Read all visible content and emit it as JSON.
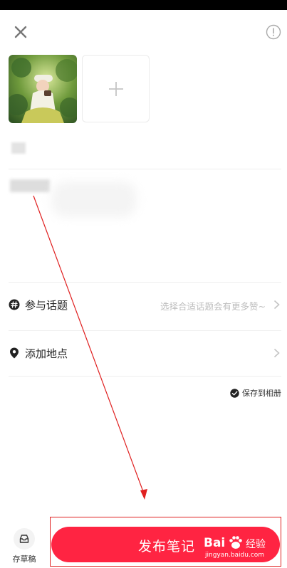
{
  "header": {
    "close_icon": "close-icon",
    "info_icon": "info-icon"
  },
  "media": {
    "add_icon": "plus-icon"
  },
  "options": {
    "topic": {
      "label": "参与话题",
      "hint": "选择合适话题会有更多赞~",
      "icon": "hashtag-icon"
    },
    "location": {
      "label": "添加地点",
      "icon": "location-pin-icon"
    },
    "save_to_album": {
      "label": "保存到相册",
      "checked": true
    }
  },
  "footer": {
    "draft_label": "存草稿",
    "publish_label": "发布笔记"
  },
  "watermark": {
    "brand": "Bai",
    "brand_cn": "经验",
    "url": "jingyan.baidu.com"
  },
  "colors": {
    "accent": "#ff2442",
    "annotation": "#e02020"
  }
}
